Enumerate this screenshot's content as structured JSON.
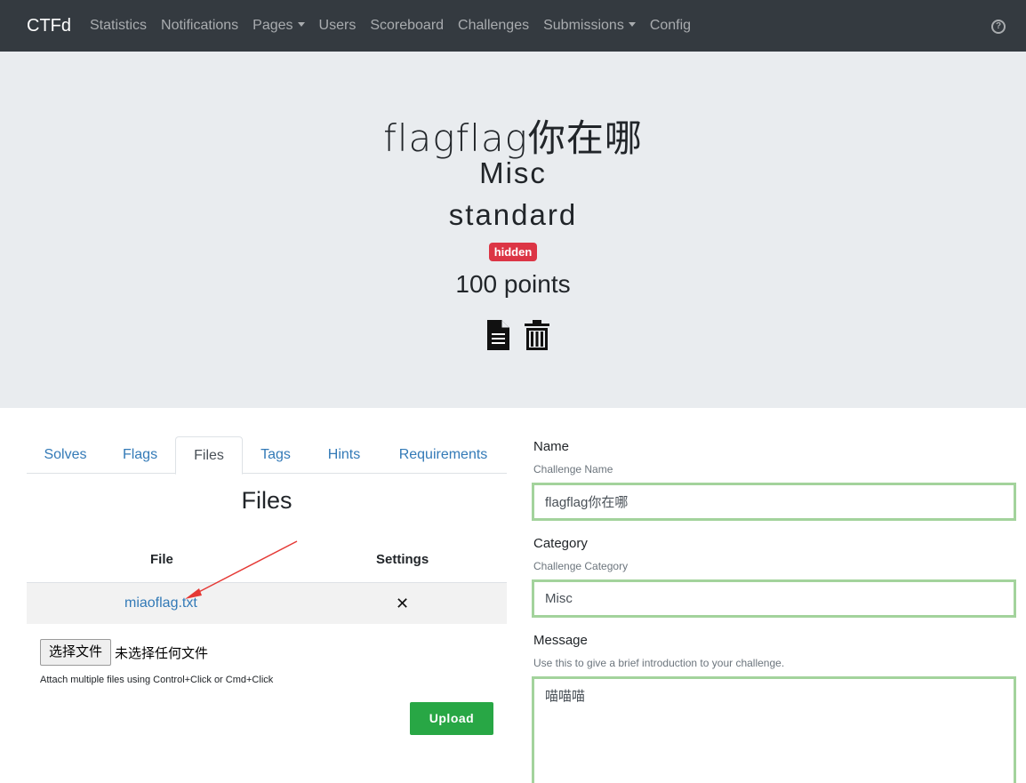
{
  "navbar": {
    "brand": "CTFd",
    "items": [
      {
        "label": "Statistics",
        "dropdown": false
      },
      {
        "label": "Notifications",
        "dropdown": false
      },
      {
        "label": "Pages",
        "dropdown": true
      },
      {
        "label": "Users",
        "dropdown": false
      },
      {
        "label": "Scoreboard",
        "dropdown": false
      },
      {
        "label": "Challenges",
        "dropdown": false
      },
      {
        "label": "Submissions",
        "dropdown": true
      },
      {
        "label": "Config",
        "dropdown": false
      }
    ],
    "help_icon": "question-circle-icon"
  },
  "challenge": {
    "name": "flagflag你在哪",
    "category": "Misc",
    "type": "standard",
    "state_badge": "hidden",
    "points": "100 points",
    "icons": [
      "file-icon",
      "trash-icon"
    ]
  },
  "tabs": [
    "Solves",
    "Flags",
    "Files",
    "Tags",
    "Hints",
    "Requirements"
  ],
  "active_tab": "Files",
  "files_panel": {
    "title": "Files",
    "col_file": "File",
    "col_settings": "Settings",
    "rows": [
      {
        "name": "miaoflag.txt",
        "delete_icon": "times-icon"
      }
    ],
    "choose_button": "选择文件",
    "no_file_text": "未选择任何文件",
    "attach_help": "Attach multiple files using Control+Click or Cmd+Click",
    "upload_button": "Upload"
  },
  "form": {
    "name_label": "Name",
    "name_help": "Challenge Name",
    "name_value": "flagflag你在哪",
    "category_label": "Category",
    "category_help": "Challenge Category",
    "category_value": "Misc",
    "message_label": "Message",
    "message_help": "Use this to give a brief introduction to your challenge.",
    "message_value": "喵喵喵"
  },
  "colors": {
    "navbar_bg": "#343a40",
    "jumbotron_bg": "#e9ecef",
    "badge_danger": "#dc3545",
    "success_green": "#28a745",
    "link_blue": "#337ab7",
    "input_valid_border": "#a3d39c",
    "annotation_arrow": "#e53935"
  }
}
